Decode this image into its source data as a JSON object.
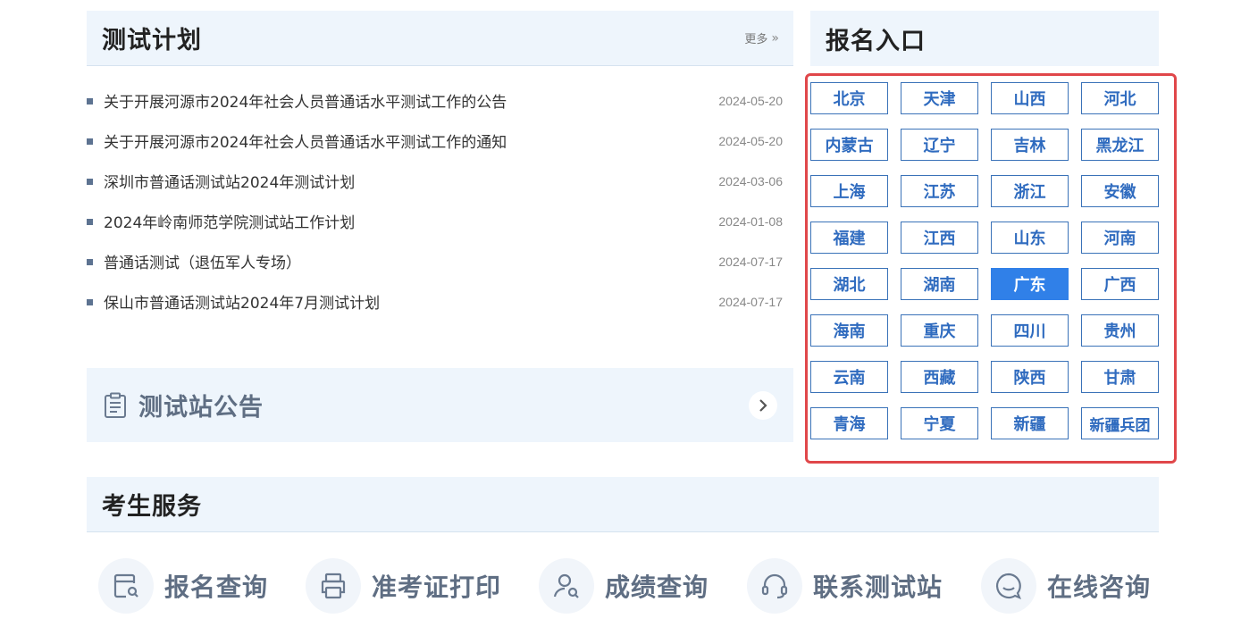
{
  "test_plan": {
    "title": "测试计划",
    "more_label": "更多",
    "items": [
      {
        "title": "关于开展河源市2024年社会人员普通话水平测试工作的公告",
        "date": "2024-05-20"
      },
      {
        "title": "关于开展河源市2024年社会人员普通话水平测试工作的通知",
        "date": "2024-05-20"
      },
      {
        "title": "深圳市普通话测试站2024年测试计划",
        "date": "2024-03-06"
      },
      {
        "title": "2024年岭南师范学院测试站工作计划",
        "date": "2024-01-08"
      },
      {
        "title": "普通话测试（退伍军人专场）",
        "date": "2024-07-17"
      },
      {
        "title": "保山市普通话测试站2024年7月测试计划",
        "date": "2024-07-17"
      }
    ]
  },
  "announcement": {
    "title": "测试站公告"
  },
  "registration": {
    "title": "报名入口",
    "active_province": "广东",
    "provinces": [
      "北京",
      "天津",
      "山西",
      "河北",
      "内蒙古",
      "辽宁",
      "吉林",
      "黑龙江",
      "上海",
      "江苏",
      "浙江",
      "安徽",
      "福建",
      "江西",
      "山东",
      "河南",
      "湖北",
      "湖南",
      "广东",
      "广西",
      "海南",
      "重庆",
      "四川",
      "贵州",
      "云南",
      "西藏",
      "陕西",
      "甘肃",
      "青海",
      "宁夏",
      "新疆",
      "新疆兵团"
    ]
  },
  "services": {
    "title": "考生服务",
    "items": [
      {
        "label": "报名查询",
        "icon": "registration-query-icon"
      },
      {
        "label": "准考证打印",
        "icon": "printer-icon"
      },
      {
        "label": "成绩查询",
        "icon": "user-search-icon"
      },
      {
        "label": "联系测试站",
        "icon": "headset-icon"
      },
      {
        "label": "在线咨询",
        "icon": "chat-icon"
      }
    ]
  },
  "colors": {
    "accent": "#3080e8",
    "highlight_border": "#e0474a",
    "panel_bg": "#eef5fc"
  }
}
